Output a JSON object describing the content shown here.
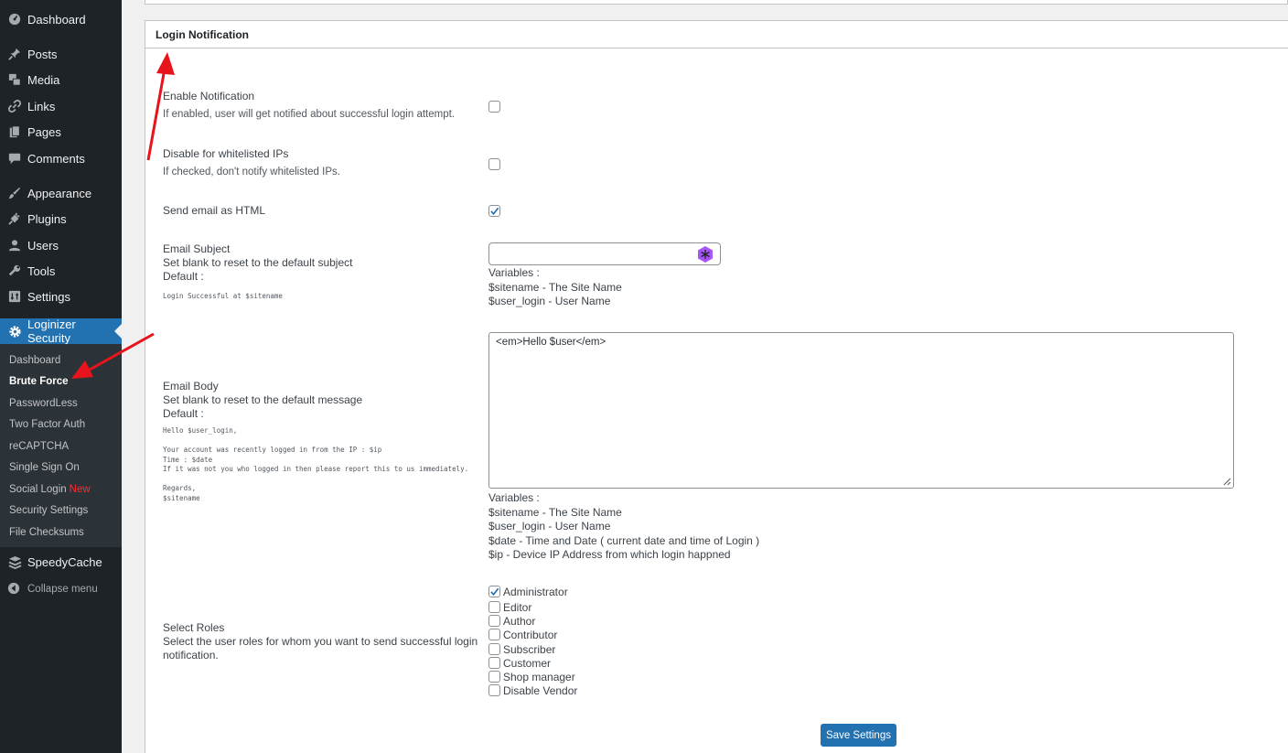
{
  "sidebar": {
    "items": [
      {
        "label": "Dashboard",
        "icon": "dashboard-icon"
      },
      {
        "label": "Posts",
        "icon": "pin-icon"
      },
      {
        "label": "Media",
        "icon": "media-icon"
      },
      {
        "label": "Links",
        "icon": "link-icon"
      },
      {
        "label": "Pages",
        "icon": "pages-icon"
      },
      {
        "label": "Comments",
        "icon": "comment-icon"
      },
      {
        "label": "Appearance",
        "icon": "brush-icon"
      },
      {
        "label": "Plugins",
        "icon": "plugin-icon"
      },
      {
        "label": "Users",
        "icon": "user-icon"
      },
      {
        "label": "Tools",
        "icon": "wrench-icon"
      },
      {
        "label": "Settings",
        "icon": "settings-icon"
      },
      {
        "label": "Loginizer Security",
        "icon": "gear-icon"
      }
    ],
    "submenu": [
      {
        "label": "Dashboard"
      },
      {
        "label": "Brute Force"
      },
      {
        "label": "PasswordLess"
      },
      {
        "label": "Two Factor Auth"
      },
      {
        "label": "reCAPTCHA"
      },
      {
        "label": "Single Sign On"
      },
      {
        "label": "Social Login",
        "badge": "New"
      },
      {
        "label": "Security Settings"
      },
      {
        "label": "File Checksums"
      }
    ],
    "speedycache": "SpeedyCache",
    "collapse": "Collapse menu"
  },
  "panel": {
    "title": "Login Notification",
    "enable": {
      "label": "Enable Notification",
      "desc": "If enabled, user will get notified about successful login attempt.",
      "checked": false
    },
    "whitelist": {
      "label": "Disable for whitelisted IPs",
      "desc": "If checked, don't notify whitelisted IPs.",
      "checked": false
    },
    "html": {
      "label": "Send email as HTML",
      "checked": true
    },
    "subject": {
      "label": "Email Subject",
      "desc": "Set blank to reset to the default subject",
      "default_label": "Default :",
      "default_value": "Login Successful at $sitename",
      "value": "",
      "vars_title": "Variables :",
      "vars": [
        "$sitename - The Site Name",
        "$user_login - User Name"
      ]
    },
    "body": {
      "label": "Email Body",
      "desc": "Set blank to reset to the default message",
      "default_label": "Default :",
      "default_value": "Hello $user_login,\n\nYour account was recently logged in from the IP : $ip\nTime : $date\nIf it was not you who logged in then please report this to us immediately.\n\nRegards,\n$sitename",
      "value": "<em>Hello $user</em>",
      "vars_title": "Variables :",
      "vars": [
        "$sitename - The Site Name",
        "$user_login - User Name",
        "$date - Time and Date ( current date and time of Login )",
        "$ip - Device IP Address from which login happned"
      ]
    },
    "roles": {
      "label": "Select Roles",
      "desc": "Select the user roles for whom you want to send successful login notification.",
      "items": [
        {
          "label": "Administrator",
          "checked": true
        },
        {
          "label": "Editor",
          "checked": false
        },
        {
          "label": "Author",
          "checked": false
        },
        {
          "label": "Contributor",
          "checked": false
        },
        {
          "label": "Subscriber",
          "checked": false
        },
        {
          "label": "Customer",
          "checked": false
        },
        {
          "label": "Shop manager",
          "checked": false
        },
        {
          "label": "Disable Vendor",
          "checked": false
        }
      ]
    },
    "save_label": "Save Settings"
  },
  "colors": {
    "sidebar_bg": "#1d2327",
    "accent": "#2271b1",
    "annotation_arrow": "#e8141c",
    "new_badge": "#ff2d2d"
  }
}
